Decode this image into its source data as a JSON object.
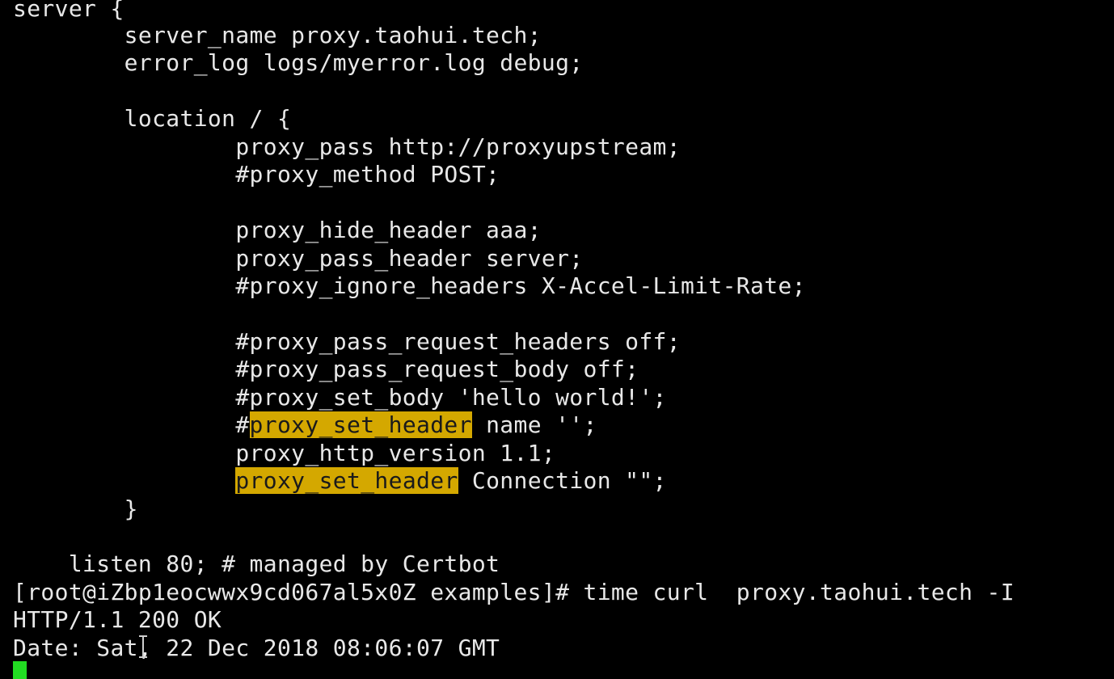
{
  "terminal": {
    "lines": [
      "server {",
      "        server_name proxy.taohui.tech;",
      "        error_log logs/myerror.log debug;",
      "",
      "        location / {",
      "                proxy_pass http://proxyupstream;",
      "                #proxy_method POST;",
      "",
      "                proxy_hide_header aaa;",
      "                proxy_pass_header server;",
      "                #proxy_ignore_headers X-Accel-Limit-Rate;",
      "",
      "                #proxy_pass_request_headers off;",
      "                #proxy_pass_request_body off;",
      "                #proxy_set_body 'hello world!';",
      "                #",
      "                proxy_http_version 1.1;",
      "                ",
      "        }",
      "",
      "    listen 80; # managed by Certbot",
      "[root@iZbp1eocwwx9cd067al5x0Z examples]# time curl  proxy.taohui.tech -I",
      "HTTP/1.1 200 OK",
      "Date: Sat, 22 Dec 2018 08:06:07 GMT"
    ],
    "highlighted_lines": {
      "line15": {
        "match": "proxy_set_header",
        "rest": " name '';"
      },
      "line17": {
        "match": "proxy_set_header",
        "rest": " Connection \"\";"
      }
    },
    "colors": {
      "background": "#000000",
      "text": "#e8e8e8",
      "search_highlight": "#d4a800",
      "cursor": "#22dd22"
    }
  }
}
